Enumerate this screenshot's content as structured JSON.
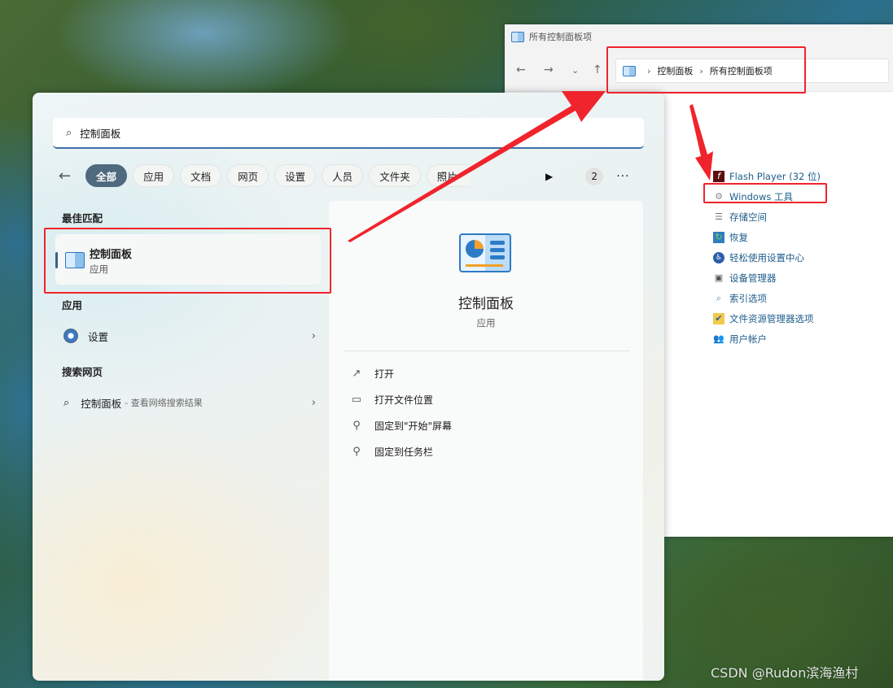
{
  "explorer": {
    "title": "所有控制面板项",
    "nav": {
      "back": "←",
      "forward": "→",
      "recent": "⌄",
      "up": "↑"
    },
    "breadcrumb": [
      "控制面板",
      "所有控制面板项"
    ],
    "items": [
      {
        "label": "Flash Player (32 位)",
        "icon": "flash-icon"
      },
      {
        "label": "Windows 工具",
        "icon": "tools-icon"
      },
      {
        "label": "存储空间",
        "icon": "storage-icon"
      },
      {
        "label": "恢复",
        "icon": "recovery-icon"
      },
      {
        "label": "轻松使用设置中心",
        "icon": "ease-of-access-icon"
      },
      {
        "label": "设备管理器",
        "icon": "device-manager-icon"
      },
      {
        "label": "索引选项",
        "icon": "indexing-icon"
      },
      {
        "label": "文件资源管理器选项",
        "icon": "folder-options-icon"
      },
      {
        "label": "用户帐户",
        "icon": "user-accounts-icon"
      }
    ]
  },
  "start": {
    "search": {
      "value": "控制面板"
    },
    "filters": [
      "全部",
      "应用",
      "文档",
      "网页",
      "设置",
      "人员",
      "文件夹",
      "照片"
    ],
    "badge_count": "2",
    "more": "···",
    "best_match": {
      "heading": "最佳匹配",
      "name": "控制面板",
      "type": "应用"
    },
    "apps": {
      "heading": "应用",
      "items": [
        {
          "label": "设置"
        }
      ]
    },
    "web": {
      "heading": "搜索网页",
      "query": "控制面板",
      "suffix": "- 查看网络搜索结果"
    },
    "preview": {
      "title": "控制面板",
      "subtitle": "应用",
      "actions": [
        {
          "label": "打开",
          "icon": "open-icon"
        },
        {
          "label": "打开文件位置",
          "icon": "folder-icon"
        },
        {
          "label": "固定到\"开始\"屏幕",
          "icon": "pin-icon"
        },
        {
          "label": "固定到任务栏",
          "icon": "pin-icon"
        }
      ]
    }
  },
  "colors": {
    "annotation_red": "#f0242c",
    "accent": "#4f6a7e",
    "link": "#1e5c8a"
  },
  "watermark": "CSDN @Rudon滨海渔村"
}
